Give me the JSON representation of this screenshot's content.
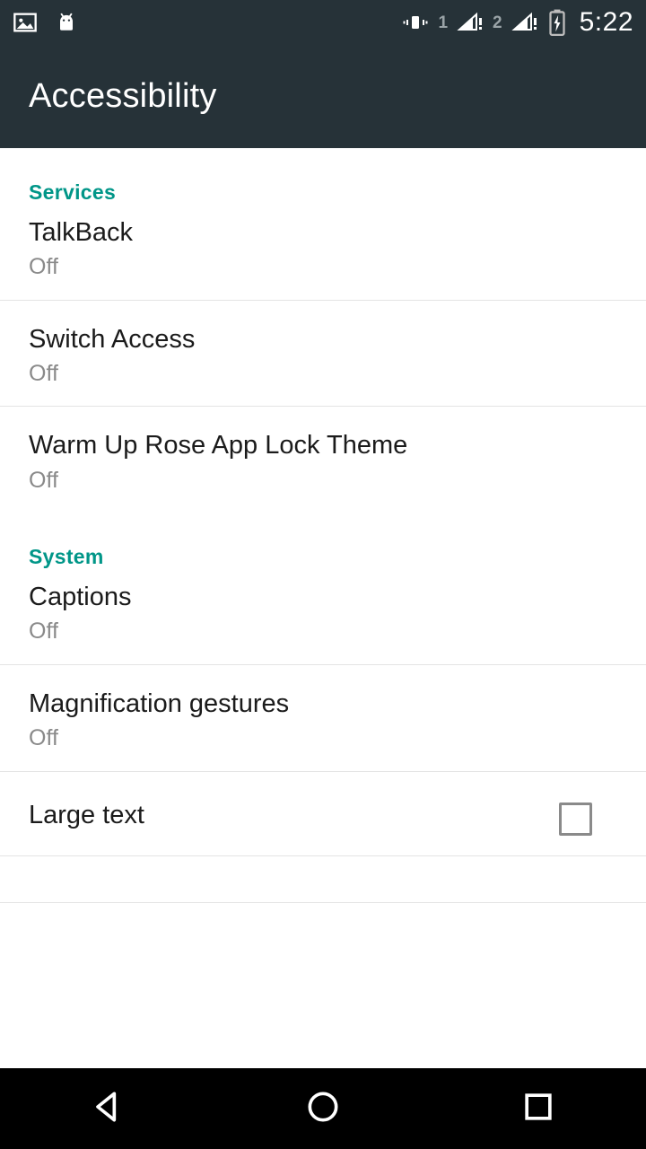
{
  "statusbar": {
    "icons": [
      "image-icon",
      "android-head-icon",
      "vibrate-icon"
    ],
    "sim1_label": "1",
    "sim2_label": "2",
    "battery": "battery-charging-icon",
    "time": "5:22"
  },
  "appbar": {
    "title": "Accessibility"
  },
  "sections": [
    {
      "header": "Services",
      "rows": [
        {
          "title": "TalkBack",
          "subtitle": "Off",
          "type": "nav"
        },
        {
          "title": "Switch Access",
          "subtitle": "Off",
          "type": "nav"
        },
        {
          "title": "Warm Up Rose App Lock Theme",
          "subtitle": "Off",
          "type": "nav"
        }
      ]
    },
    {
      "header": "System",
      "rows": [
        {
          "title": "Captions",
          "subtitle": "Off",
          "type": "nav"
        },
        {
          "title": "Magnification gestures",
          "subtitle": "Off",
          "type": "nav"
        },
        {
          "title": "Large text",
          "subtitle": "",
          "type": "checkbox",
          "checked": false
        }
      ]
    }
  ],
  "navbar": {
    "back": "back-triangle-icon",
    "home": "home-circle-icon",
    "recents": "recents-square-icon"
  },
  "colors": {
    "accent": "#009688",
    "appbar_bg": "#263238",
    "primary_text": "#1b1b1b",
    "secondary_text": "#8a8a8a"
  }
}
